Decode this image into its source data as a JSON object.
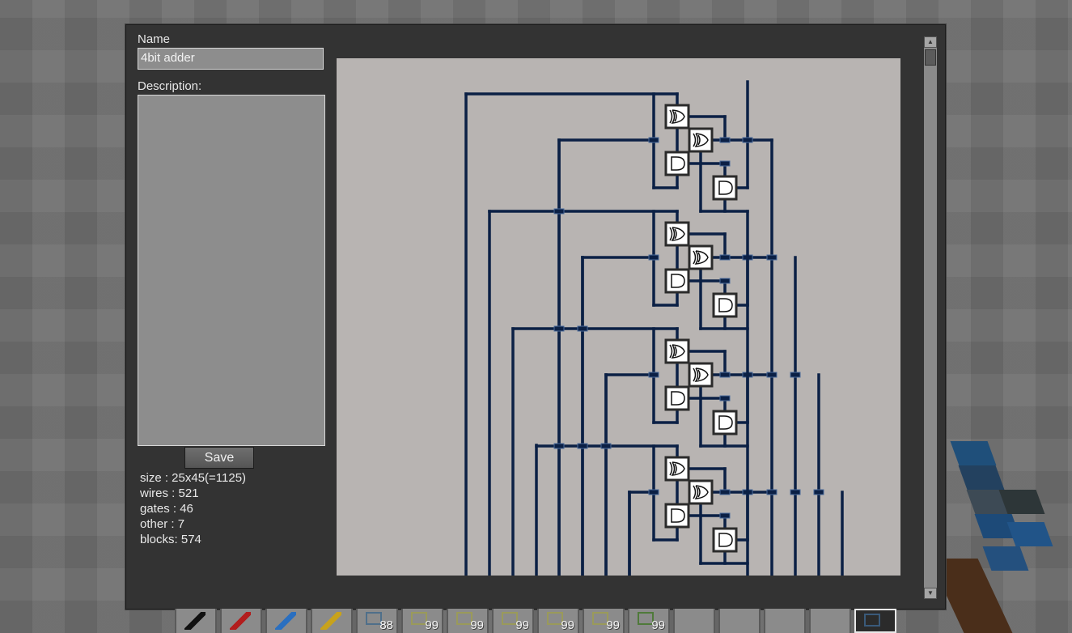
{
  "dialog": {
    "name_label": "Name",
    "name_value": "4bit adder",
    "description_label": "Description:",
    "description_value": "",
    "save_label": "Save"
  },
  "stats": {
    "size": "size : 25x45(=1125)",
    "wires": "wires : 521",
    "gates": "gates : 46",
    "other": "other : 7",
    "blocks": "blocks: 574"
  },
  "circuit": {
    "wire_color": "#0b2045",
    "background": "#b8b4b2",
    "gate_fill": "#ffffff",
    "gate_border": "#2b2b2b"
  },
  "hotbar": {
    "slots": [
      {
        "icon": "black-wire-icon",
        "count": ""
      },
      {
        "icon": "red-wire-icon",
        "count": ""
      },
      {
        "icon": "blue-wire-icon",
        "count": ""
      },
      {
        "icon": "yellow-wire-icon",
        "count": ""
      },
      {
        "icon": "not-gate-icon",
        "count": "88"
      },
      {
        "icon": "and-gate-icon",
        "count": "99"
      },
      {
        "icon": "or-gate-icon",
        "count": "99"
      },
      {
        "icon": "nand-gate-icon",
        "count": "99"
      },
      {
        "icon": "nor-gate-icon",
        "count": "99"
      },
      {
        "icon": "xor-gate-icon",
        "count": "99"
      },
      {
        "icon": "plant-icon",
        "count": "99"
      },
      {
        "icon": "empty-slot",
        "count": ""
      },
      {
        "icon": "empty-slot",
        "count": ""
      },
      {
        "icon": "empty-slot",
        "count": ""
      },
      {
        "icon": "empty-slot",
        "count": ""
      },
      {
        "icon": "tool-icon",
        "count": ""
      }
    ]
  }
}
